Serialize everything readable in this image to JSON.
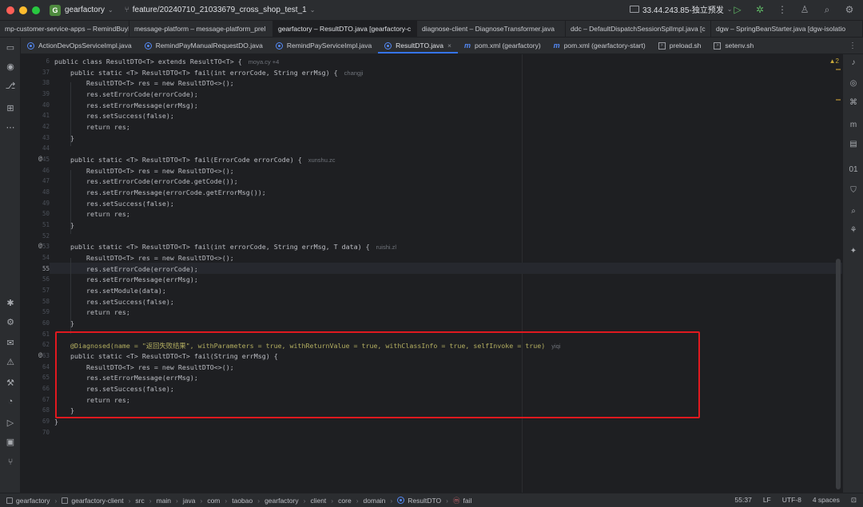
{
  "window": {
    "project_initial": "G",
    "project_name": "gearfactory",
    "branch": "feature/20240710_21033679_cross_shop_test_1",
    "run_config": "33.44.243.85-独立预发"
  },
  "top_tabs": [
    {
      "label": "mp-customer-service-apps – RemindBuyMa",
      "active": false
    },
    {
      "label": "message-platform – message-platform_prel",
      "active": false
    },
    {
      "label": "gearfactory – ResultDTO.java [gearfactory-c",
      "active": true
    },
    {
      "label": "diagnose-client – DiagnoseTransformer.java",
      "active": false
    },
    {
      "label": "ddc – DefaultDispatchSessionSplImpl.java [c",
      "active": false
    },
    {
      "label": "dgw – SpringBeanStarter.java [dgw-isolatio",
      "active": false
    }
  ],
  "file_tabs": [
    {
      "label": "ActionDevOpsServiceImpl.java",
      "icon": "class",
      "active": false
    },
    {
      "label": "RemindPayManualRequestDO.java",
      "icon": "class",
      "active": false
    },
    {
      "label": "RemindPayServiceImpl.java",
      "icon": "class",
      "active": false
    },
    {
      "label": "ResultDTO.java",
      "icon": "class",
      "active": true
    },
    {
      "label": "pom.xml (gearfactory)",
      "icon": "maven",
      "active": false
    },
    {
      "label": "pom.xml (gearfactory-start)",
      "icon": "maven",
      "active": false
    },
    {
      "label": "preload.sh",
      "icon": "shell",
      "active": false
    },
    {
      "label": "setenv.sh",
      "icon": "shell",
      "active": false
    }
  ],
  "editor": {
    "warning_count": "▲2",
    "lines": [
      {
        "n": "6",
        "author": "moya.cy +4"
      },
      {
        "n": "37",
        "author": "changji"
      },
      {
        "n": "38"
      },
      {
        "n": "39"
      },
      {
        "n": "40"
      },
      {
        "n": "41"
      },
      {
        "n": "42"
      },
      {
        "n": "43"
      },
      {
        "n": "44"
      },
      {
        "n": "45",
        "author": "xunshu.zc"
      },
      {
        "n": "46"
      },
      {
        "n": "47"
      },
      {
        "n": "48"
      },
      {
        "n": "49"
      },
      {
        "n": "50"
      },
      {
        "n": "51"
      },
      {
        "n": "52"
      },
      {
        "n": "53",
        "author": "ruishi.zl"
      },
      {
        "n": "54"
      },
      {
        "n": "55"
      },
      {
        "n": "56"
      },
      {
        "n": "57"
      },
      {
        "n": "58"
      },
      {
        "n": "59"
      },
      {
        "n": "60"
      },
      {
        "n": "61"
      },
      {
        "n": "62",
        "author": "yiqi"
      },
      {
        "n": "63"
      },
      {
        "n": "64"
      },
      {
        "n": "65"
      },
      {
        "n": "66"
      },
      {
        "n": "67"
      },
      {
        "n": "68"
      },
      {
        "n": "69"
      },
      {
        "n": "70"
      }
    ]
  },
  "code": {
    "l6": "public class ResultDTO<T> extends ResultTO<T> {",
    "l37": "    public static <T> ResultDTO<T> fail(int errorCode, String errMsg) {",
    "l38": "        ResultDTO<T> res = new ResultDTO<>();",
    "l39": "        res.setErrorCode(errorCode);",
    "l40": "        res.setErrorMessage(errMsg);",
    "l41": "        res.setSuccess(false);",
    "l42": "        return res;",
    "l43": "    }",
    "l45": "    public static <T> ResultDTO<T> fail(ErrorCode errorCode) {",
    "l46": "        ResultDTO<T> res = new ResultDTO<>();",
    "l47": "        res.setErrorCode(errorCode.getCode());",
    "l48": "        res.setErrorMessage(errorCode.getErrorMsg());",
    "l49": "        res.setSuccess(false);",
    "l50": "        return res;",
    "l51": "    }",
    "l53": "    public static <T> ResultDTO<T> fail(int errorCode, String errMsg, T data) {",
    "l54": "        ResultDTO<T> res = new ResultDTO<>();",
    "l55": "        res.setErrorCode(errorCode);",
    "l56": "        res.setErrorMessage(errMsg);",
    "l57": "        res.setModule(data);",
    "l58": "        res.setSuccess(false);",
    "l59": "        return res;",
    "l60": "    }",
    "l62": "    @Diagnosed(name = \"返回失败结果\", withParameters = true, withReturnValue = true, withClassInfo = true, selfInvoke = true)",
    "l63": "    public static <T> ResultDTO<T> fail(String errMsg) {",
    "l64": "        ResultDTO<T> res = new ResultDTO<>();",
    "l65": "        res.setErrorMessage(errMsg);",
    "l66": "        res.setSuccess(false);",
    "l67": "        return res;",
    "l68": "    }",
    "l69": "}"
  },
  "statusbar": {
    "breadcrumbs": [
      "gearfactory",
      "gearfactory-client",
      "src",
      "main",
      "java",
      "com",
      "taobao",
      "gearfactory",
      "client",
      "core",
      "domain",
      "ResultDTO",
      "fail"
    ],
    "position": "55:37",
    "line_ending": "LF",
    "encoding": "UTF-8",
    "indent": "4 spaces"
  },
  "colors": {
    "highlight_box": "#e0191f",
    "accent": "#3574f0"
  }
}
